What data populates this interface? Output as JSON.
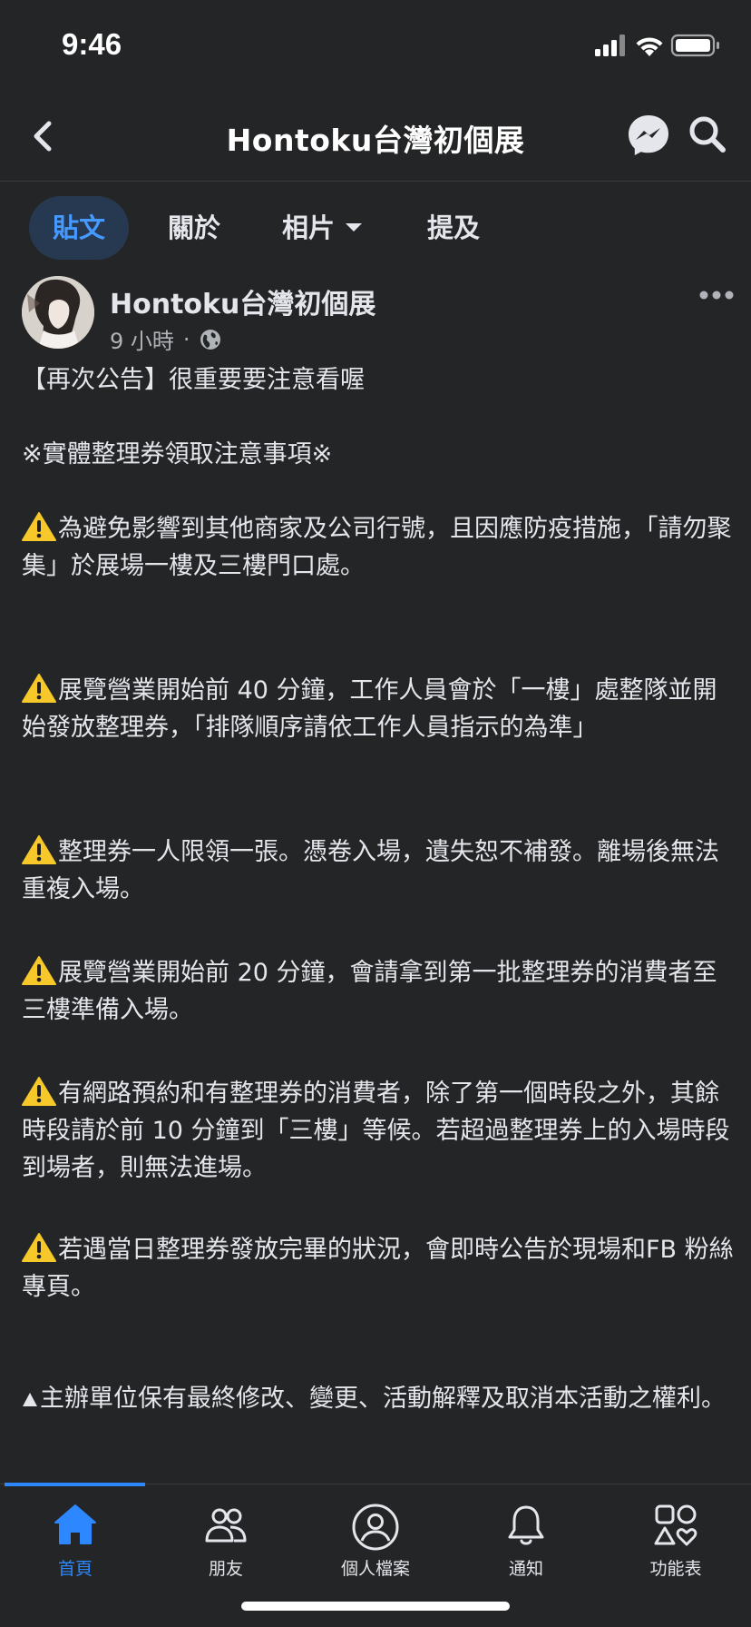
{
  "status": {
    "time": "9:46"
  },
  "nav": {
    "title": "Hontoku台灣初個展"
  },
  "tabs": [
    {
      "label": "貼文"
    },
    {
      "label": "關於"
    },
    {
      "label": "相片"
    },
    {
      "label": "提及"
    }
  ],
  "post": {
    "author": "Hontoku台灣初個展",
    "time": "9 小時",
    "dot": "·",
    "lines": {
      "l1": "【再次公告】很重要要注意看喔",
      "l2": "※實體整理券領取注意事項※",
      "l3": "為避免影響到其他商家及公司行號，且因應防疫措施，「請勿聚集」於展場一樓及三樓門口處。",
      "l4": "展覽營業開始前 40 分鐘，工作人員會於「一樓」處整隊並開始發放整理券，「排隊順序請依工作人員指示的為準」",
      "l5": "整理券一人限領一張。憑卷入場，遺失恕不補發。離場後無法重複入場。",
      "l6": "展覽營業開始前 20 分鐘，會請拿到第一批整理券的消費者至三樓準備入場。",
      "l7": "有網路預約和有整理券的消費者，除了第一個時段之外，其餘時段請於前 10 分鐘到「三樓」等候。若超過整理券上的入場時段到場者，則無法進場。",
      "l8": "若遇當日整理券發放完畢的狀況，會即時公告於現場和FB 粉絲專頁。",
      "l9": "主辦單位保有最終修改、變更、活動解釋及取消本活動之權利。"
    }
  },
  "bottom_nav": [
    {
      "label": "首頁",
      "icon": "home-icon"
    },
    {
      "label": "朋友",
      "icon": "friends-icon"
    },
    {
      "label": "個人檔案",
      "icon": "profile-icon"
    },
    {
      "label": "通知",
      "icon": "bell-icon"
    },
    {
      "label": "功能表",
      "icon": "menu-shapes-icon"
    }
  ],
  "colors": {
    "background": "#242526",
    "accent": "#2d88ff",
    "active_tab_bg": "#263951",
    "text": "#e4e6eb",
    "secondary_text": "#b0b3b8"
  }
}
